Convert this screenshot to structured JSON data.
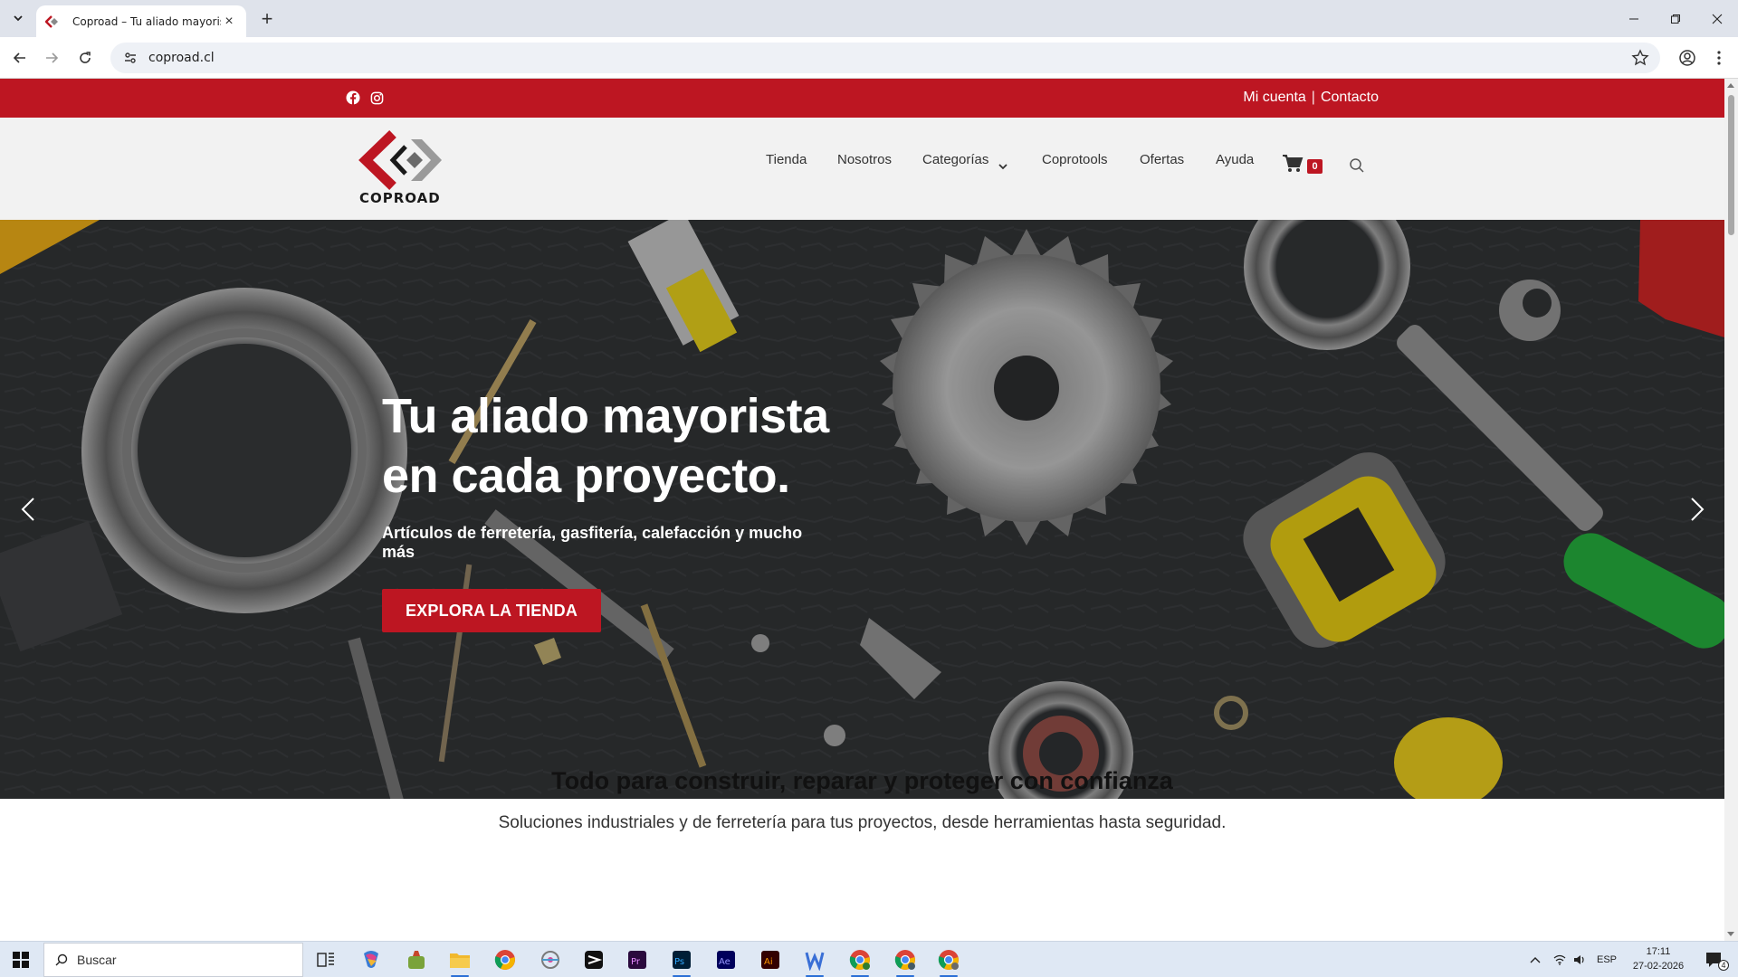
{
  "browser": {
    "tab_title": "Coproad – Tu aliado mayorista",
    "url": "coproad.cl",
    "tab_close": "×",
    "new_tab": "+"
  },
  "site": {
    "toplinks": {
      "account": "Mi cuenta",
      "separator": "|",
      "contact": "Contacto"
    },
    "logo_text": "COPROAD",
    "nav": [
      {
        "label": "Tienda"
      },
      {
        "label": "Nosotros"
      },
      {
        "label": "Categorías"
      },
      {
        "label": "Coprotools"
      },
      {
        "label": "Ofertas"
      },
      {
        "label": "Ayuda"
      }
    ],
    "cart_count": "0",
    "hero": {
      "title_line1": "Tu aliado mayorista",
      "title_line2": "en cada proyecto.",
      "subtitle": "Artículos de ferretería, gasfitería, calefacción y mucho más",
      "cta": "EXPLORA LA TIENDA"
    },
    "section": {
      "title": "Todo para construir, reparar y proteger con confianza",
      "subtitle": "Soluciones industriales y de ferretería para tus proyectos, desde herramientas hasta seguridad."
    },
    "colors": {
      "brand_red": "#bd1622",
      "header_bg": "#f2f2f2"
    }
  },
  "taskbar": {
    "search_placeholder": "Buscar",
    "lang": "ESP",
    "time": "17:11",
    "date": "27-02-2026",
    "notifications": "4",
    "apps": [
      "task-view",
      "copilot",
      "game",
      "file-explorer",
      "chrome",
      "network-app",
      "capcut",
      "premiere-pro",
      "photoshop",
      "after-effects",
      "illustrator",
      "wp-app",
      "chrome-profile-1",
      "chrome-profile-2",
      "chrome-profile-3"
    ]
  }
}
